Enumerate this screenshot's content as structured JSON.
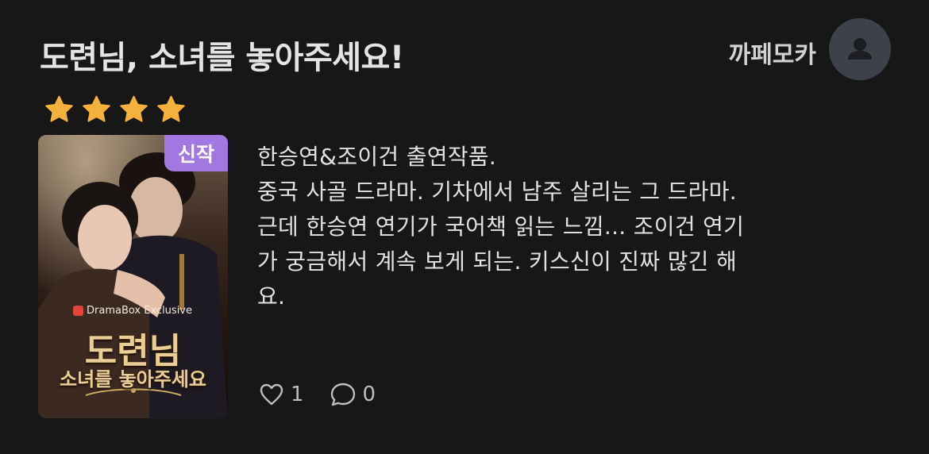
{
  "post": {
    "title": "도련님, 소녀를 놓아주세요!",
    "author": "까페모카",
    "rating": 4,
    "rating_color": "#f5b23a",
    "badge": "신작",
    "badge_color": "#a078e0",
    "poster": {
      "exclusive_label": "DramaBox Exclusive",
      "title_line1": "도련님",
      "title_line2": "소녀를 놓아주세요"
    },
    "review_lines": [
      "한승연&조이건 출연작품.",
      "중국 사골 드라마. 기차에서 남주 살리는 그 드라마.",
      "근데 한승연 연기가 국어책 읽는 느낌... 조이건 연기",
      "가 궁금해서 계속 보게 되는. 키스신이 진짜 많긴 해",
      "요."
    ],
    "likes": "1",
    "comments": "0"
  },
  "icons": {
    "avatar": "user-icon",
    "like": "heart-outline-icon",
    "comment": "speech-bubble-icon",
    "star": "star-icon"
  }
}
